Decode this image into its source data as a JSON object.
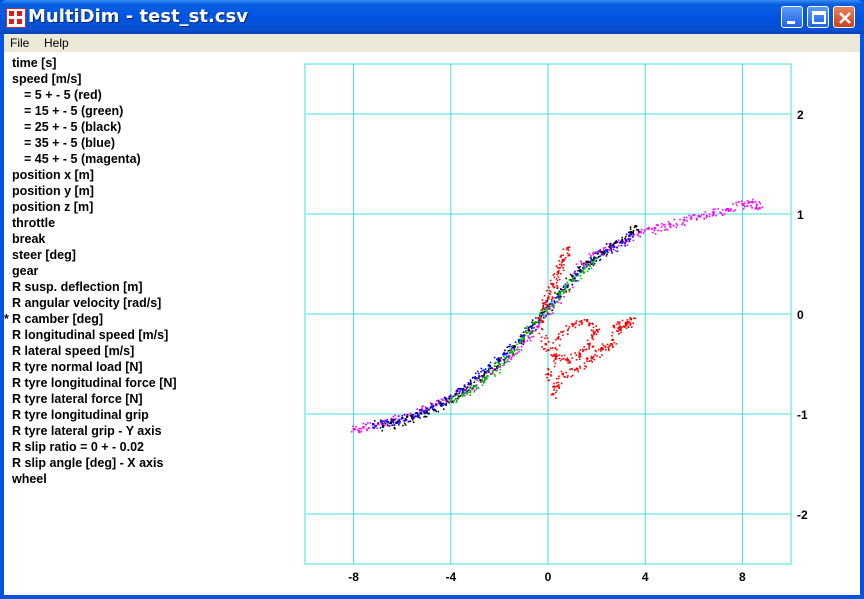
{
  "window": {
    "title": "MultiDim - test_st.csv",
    "icon": "app-grid-icon",
    "controls": [
      "minimize-icon",
      "maximize-icon",
      "close-icon"
    ]
  },
  "menu": [
    {
      "label": "File"
    },
    {
      "label": "Help"
    }
  ],
  "variables": [
    {
      "label": "time [s]",
      "indent": 0,
      "marker": ""
    },
    {
      "label": "speed [m/s]",
      "indent": 0,
      "marker": ""
    },
    {
      "label": "= 5 + - 5 (red)",
      "indent": 1,
      "marker": ""
    },
    {
      "label": "= 15 + - 5 (green)",
      "indent": 1,
      "marker": ""
    },
    {
      "label": "= 25 + - 5 (black)",
      "indent": 1,
      "marker": ""
    },
    {
      "label": "= 35 + - 5 (blue)",
      "indent": 1,
      "marker": ""
    },
    {
      "label": "= 45 + - 5 (magenta)",
      "indent": 1,
      "marker": ""
    },
    {
      "label": "position x [m]",
      "indent": 0,
      "marker": ""
    },
    {
      "label": "position y [m]",
      "indent": 0,
      "marker": ""
    },
    {
      "label": "position z [m]",
      "indent": 0,
      "marker": ""
    },
    {
      "label": "throttle",
      "indent": 0,
      "marker": ""
    },
    {
      "label": "break",
      "indent": 0,
      "marker": ""
    },
    {
      "label": "steer [deg]",
      "indent": 0,
      "marker": ""
    },
    {
      "label": "gear",
      "indent": 0,
      "marker": ""
    },
    {
      "label": "R susp. deflection [m]",
      "indent": 0,
      "marker": ""
    },
    {
      "label": "R angular velocity [rad/s]",
      "indent": 0,
      "marker": ""
    },
    {
      "label": "R camber [deg]",
      "indent": 0,
      "marker": "*"
    },
    {
      "label": "R longitudinal speed [m/s]",
      "indent": 0,
      "marker": ""
    },
    {
      "label": "R lateral speed [m/s]",
      "indent": 0,
      "marker": ""
    },
    {
      "label": "R tyre normal load [N]",
      "indent": 0,
      "marker": ""
    },
    {
      "label": "R tyre longitudinal force [N]",
      "indent": 0,
      "marker": ""
    },
    {
      "label": "R tyre lateral force [N]",
      "indent": 0,
      "marker": ""
    },
    {
      "label": "R tyre longitudinal grip",
      "indent": 0,
      "marker": ""
    },
    {
      "label": "R tyre lateral grip - Y axis",
      "indent": 0,
      "marker": ""
    },
    {
      "label": "R slip ratio = 0 + - 0.02",
      "indent": 0,
      "marker": ""
    },
    {
      "label": "R slip angle [deg] - X axis",
      "indent": 0,
      "marker": ""
    },
    {
      "label": "wheel",
      "indent": 0,
      "marker": ""
    }
  ],
  "chart_data": {
    "type": "scatter",
    "xlim": [
      -10,
      10
    ],
    "ylim": [
      -2.5,
      2.5
    ],
    "xticks": [
      -8,
      -4,
      0,
      4,
      8
    ],
    "yticks": [
      2,
      1,
      0,
      -1,
      -2
    ],
    "xgrid": [
      -8,
      -4,
      0,
      4,
      8
    ],
    "ygrid": [
      2,
      1,
      0,
      -1,
      -2
    ],
    "grid": true,
    "grid_color": "#40e0e0",
    "series": [
      {
        "color": "#ff00ff",
        "points": [
          [
            -8.0,
            -1.15
          ],
          [
            -7.6,
            -1.13
          ],
          [
            -7.0,
            -1.1
          ],
          [
            -6.4,
            -1.06
          ],
          [
            -5.8,
            -1.02
          ],
          [
            -5.2,
            -0.96
          ],
          [
            -4.6,
            -0.9
          ],
          [
            -4.0,
            -0.84
          ],
          [
            -3.4,
            -0.76
          ],
          [
            -2.8,
            -0.66
          ],
          [
            -2.2,
            -0.55
          ],
          [
            -1.6,
            -0.42
          ],
          [
            -1.0,
            -0.28
          ],
          [
            -0.4,
            -0.12
          ],
          [
            0.2,
            0.08
          ],
          [
            0.8,
            0.28
          ],
          [
            1.4,
            0.5
          ],
          [
            2.0,
            0.62
          ],
          [
            2.6,
            0.68
          ],
          [
            3.2,
            0.74
          ],
          [
            3.8,
            0.82
          ],
          [
            4.4,
            0.86
          ],
          [
            5.0,
            0.9
          ],
          [
            5.6,
            0.94
          ],
          [
            6.2,
            0.98
          ],
          [
            6.8,
            1.02
          ],
          [
            7.4,
            1.05
          ],
          [
            8.0,
            1.1
          ],
          [
            8.4,
            1.12
          ],
          [
            8.7,
            1.06
          ]
        ]
      },
      {
        "color": "#000000",
        "points": [
          [
            -6.8,
            -1.12
          ],
          [
            -6.2,
            -1.08
          ],
          [
            -5.6,
            -1.03
          ],
          [
            -5.0,
            -0.98
          ],
          [
            -4.4,
            -0.9
          ],
          [
            -3.8,
            -0.8
          ],
          [
            -3.2,
            -0.7
          ],
          [
            -2.6,
            -0.58
          ],
          [
            -2.0,
            -0.46
          ],
          [
            -1.4,
            -0.32
          ],
          [
            -0.8,
            -0.16
          ],
          [
            -0.2,
            0.02
          ],
          [
            0.4,
            0.2
          ],
          [
            1.0,
            0.38
          ],
          [
            1.6,
            0.52
          ],
          [
            2.2,
            0.62
          ],
          [
            2.8,
            0.72
          ],
          [
            3.4,
            0.82
          ],
          [
            3.6,
            0.88
          ]
        ]
      },
      {
        "color": "#0000ff",
        "points": [
          [
            -7.2,
            -1.1
          ],
          [
            -6.6,
            -1.08
          ],
          [
            -6.0,
            -1.04
          ],
          [
            -5.4,
            -0.99
          ],
          [
            -4.8,
            -0.93
          ],
          [
            -4.2,
            -0.85
          ],
          [
            -3.6,
            -0.75
          ],
          [
            -3.0,
            -0.64
          ],
          [
            -2.4,
            -0.52
          ],
          [
            -1.8,
            -0.4
          ],
          [
            -1.2,
            -0.26
          ],
          [
            -0.6,
            -0.1
          ],
          [
            0.0,
            0.08
          ],
          [
            0.6,
            0.24
          ],
          [
            1.2,
            0.4
          ],
          [
            1.8,
            0.54
          ],
          [
            2.4,
            0.64
          ],
          [
            3.0,
            0.72
          ],
          [
            3.4,
            0.8
          ]
        ]
      },
      {
        "color": "#00c000",
        "points": [
          [
            -4.0,
            -0.86
          ],
          [
            -3.5,
            -0.8
          ],
          [
            -3.0,
            -0.72
          ],
          [
            -2.5,
            -0.62
          ],
          [
            -2.0,
            -0.5
          ],
          [
            -1.5,
            -0.38
          ],
          [
            -1.0,
            -0.24
          ],
          [
            -0.5,
            -0.08
          ],
          [
            0.0,
            0.06
          ],
          [
            0.5,
            0.2
          ],
          [
            1.0,
            0.34
          ],
          [
            1.5,
            0.46
          ],
          [
            2.0,
            0.56
          ]
        ]
      },
      {
        "color": "#ff0000",
        "points": [
          [
            -0.2,
            0.06
          ],
          [
            0.0,
            0.16
          ],
          [
            0.2,
            0.3
          ],
          [
            0.4,
            0.42
          ],
          [
            0.6,
            0.54
          ],
          [
            0.8,
            0.66
          ],
          [
            -0.4,
            -0.04
          ],
          [
            -0.1,
            -0.3
          ],
          [
            0.3,
            -0.42
          ],
          [
            0.8,
            -0.46
          ],
          [
            1.3,
            -0.4
          ],
          [
            1.7,
            -0.3
          ],
          [
            2.0,
            -0.16
          ],
          [
            1.6,
            -0.06
          ],
          [
            1.0,
            -0.1
          ],
          [
            0.4,
            -0.24
          ],
          [
            0.0,
            -0.6
          ],
          [
            0.2,
            -0.8
          ],
          [
            0.6,
            -0.6
          ],
          [
            1.2,
            -0.55
          ],
          [
            1.8,
            -0.44
          ],
          [
            2.2,
            -0.34
          ],
          [
            2.6,
            -0.3
          ],
          [
            2.9,
            -0.14
          ],
          [
            3.2,
            -0.1
          ],
          [
            3.4,
            -0.05
          ],
          [
            2.7,
            -0.12
          ]
        ]
      }
    ]
  }
}
